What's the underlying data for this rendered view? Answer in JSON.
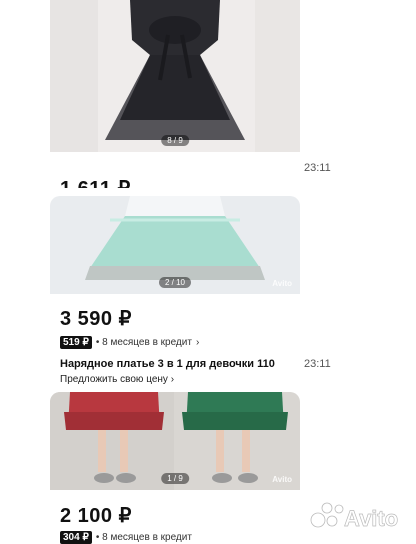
{
  "listings": [
    {
      "photo_counter": "8 / 9",
      "price": "1 611 ₽",
      "time": "23:11"
    },
    {
      "photo_counter": "2 / 10",
      "watermark": "Avito",
      "price": "3 590 ₽",
      "credit_badge": "519 ₽",
      "credit_text": "• 8 месяцев в кредит",
      "title": "Нарядное платье 3 в 1 для девочки 110",
      "offer": "Предложить свою цену",
      "time": "23:11"
    },
    {
      "photo_counter": "1 / 9",
      "watermark": "Avito",
      "price": "2 100 ₽",
      "credit_badge": "304 ₽",
      "credit_text": "• 8 месяцев в кредит"
    }
  ],
  "logo_text": "Avito",
  "colors": {
    "dress_black": "#2b2b30",
    "dress_mint": "#a9ddd0",
    "dress_red": "#b8383f",
    "dress_green": "#2f7a55"
  }
}
